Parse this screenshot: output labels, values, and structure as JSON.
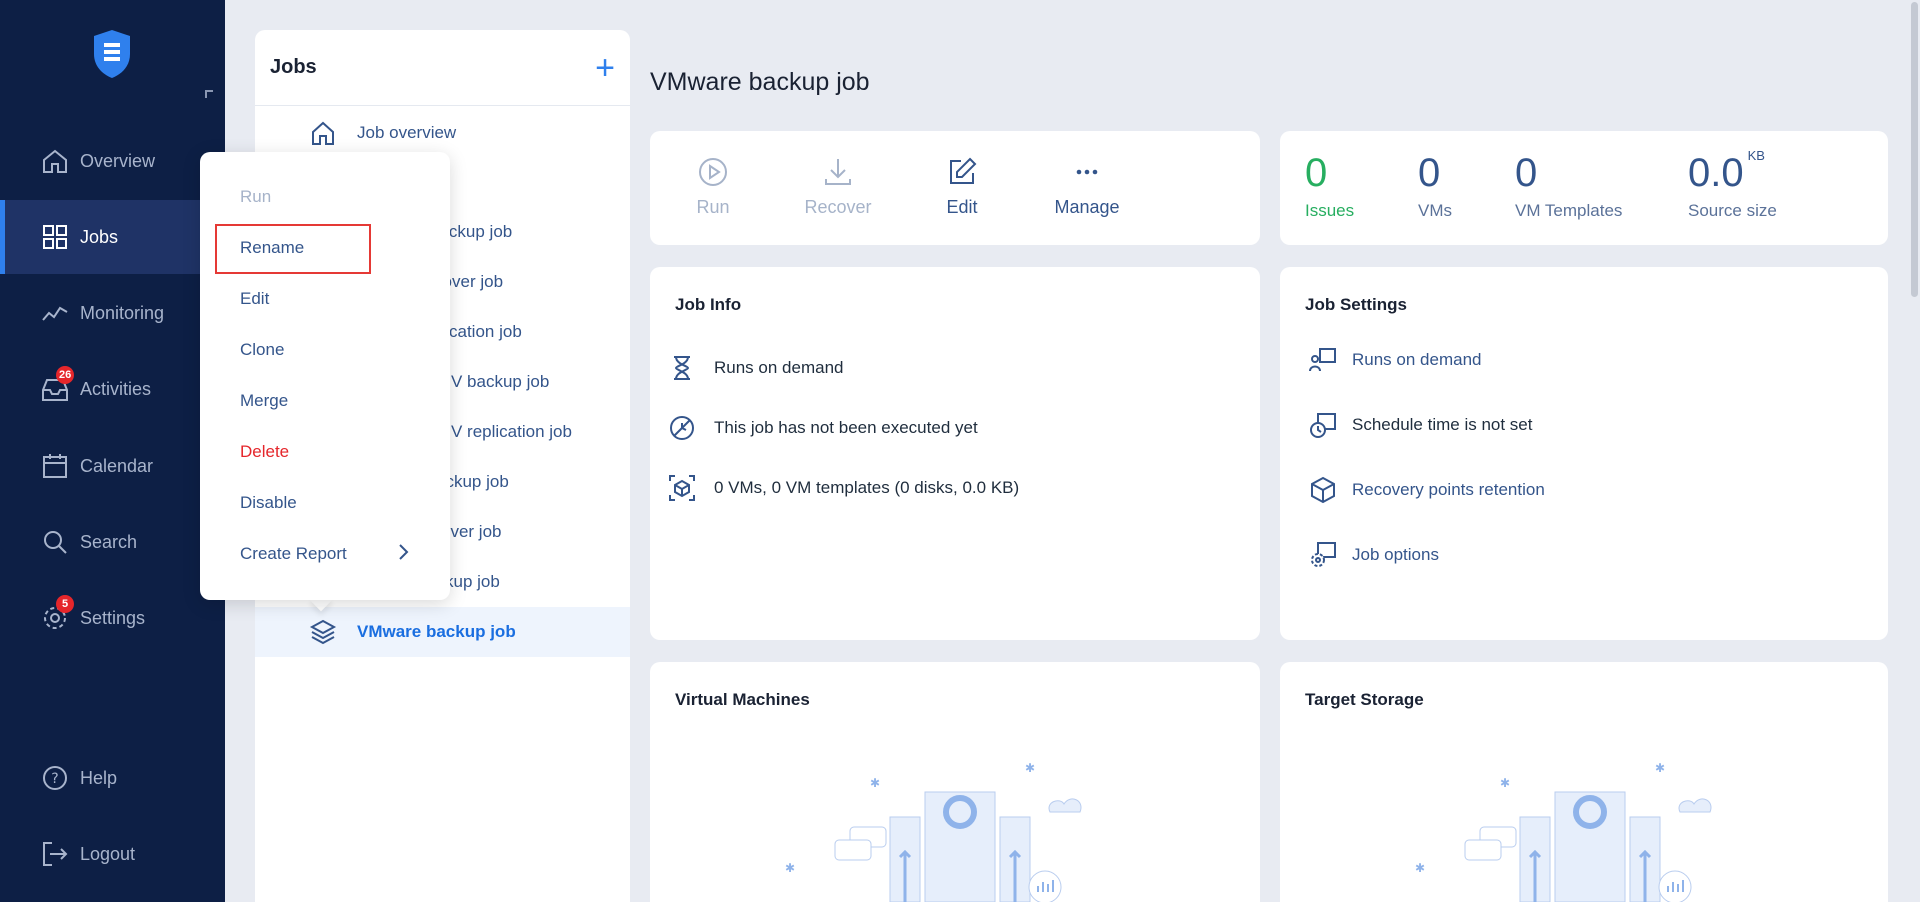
{
  "sidebar": {
    "items": [
      {
        "label": "Overview",
        "icon": "home-icon"
      },
      {
        "label": "Jobs",
        "icon": "grid-icon",
        "active": true
      },
      {
        "label": "Monitoring",
        "icon": "monitoring-icon"
      },
      {
        "label": "Activities",
        "icon": "inbox-icon",
        "badge": "26"
      },
      {
        "label": "Calendar",
        "icon": "calendar-icon"
      },
      {
        "label": "Search",
        "icon": "search-icon"
      },
      {
        "label": "Settings",
        "icon": "gear-icon",
        "badge": "5"
      }
    ],
    "bottom": [
      {
        "label": "Help",
        "icon": "help-icon"
      },
      {
        "label": "Logout",
        "icon": "logout-icon"
      }
    ]
  },
  "jobs_panel": {
    "title": "Jobs",
    "overview_label": "Job overview",
    "visible_rows": [
      "backup job",
      "ilover job",
      "plication job",
      "V backup job",
      "V replication job",
      "ackup job",
      "over job",
      "kup job"
    ],
    "selected": "VMware backup job"
  },
  "context_menu": {
    "items": [
      "Run",
      "Rename",
      "Edit",
      "Clone",
      "Merge",
      "Delete",
      "Disable",
      "Create Report"
    ],
    "highlighted": "Rename",
    "disabled": "Run",
    "danger": "Delete"
  },
  "main": {
    "title": "VMware backup job",
    "toolbar": {
      "run": "Run",
      "recover": "Recover",
      "edit": "Edit",
      "manage": "Manage"
    },
    "stats": {
      "issues": {
        "value": "0",
        "label": "Issues"
      },
      "vms": {
        "value": "0",
        "label": "VMs"
      },
      "vm_templates": {
        "value": "0",
        "label": "VM Templates"
      },
      "source_size": {
        "value": "0.0",
        "unit": "KB",
        "label": "Source size"
      }
    },
    "job_info": {
      "title": "Job Info",
      "rows": [
        "Runs on demand",
        "This job has not been executed yet",
        "0 VMs, 0 VM templates (0 disks, 0.0 KB)"
      ]
    },
    "job_settings": {
      "title": "Job Settings",
      "rows": [
        "Runs on demand",
        "Schedule time is not set",
        "Recovery points retention",
        "Job options"
      ]
    },
    "virtual_machines": {
      "title": "Virtual Machines"
    },
    "target_storage": {
      "title": "Target Storage"
    }
  },
  "colors": {
    "sidebar_bg": "#0d1f45",
    "accent": "#2f80ed",
    "danger": "#e5262b",
    "success": "#27ae60"
  }
}
